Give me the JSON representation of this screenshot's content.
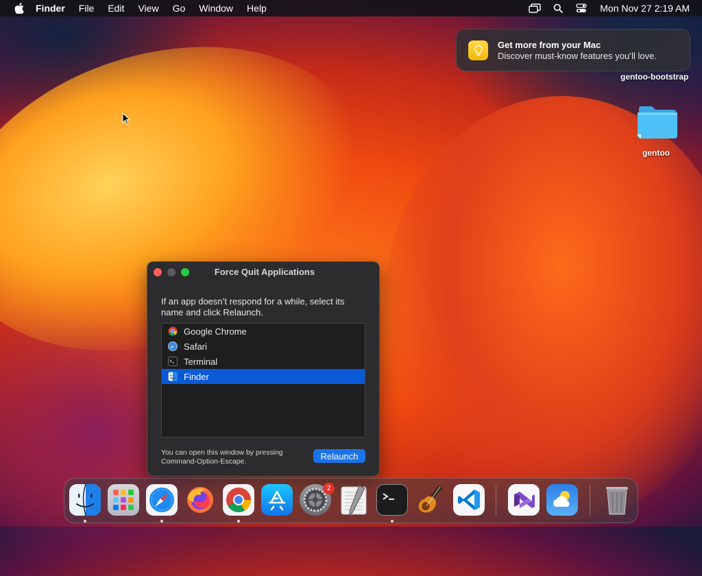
{
  "menubar": {
    "app": "Finder",
    "items": [
      "File",
      "Edit",
      "View",
      "Go",
      "Window",
      "Help"
    ],
    "clock": "Mon Nov 27  2:19 AM"
  },
  "notification": {
    "title": "Get more from your Mac",
    "body": "Discover must-know features you’ll love."
  },
  "desktop": {
    "items": [
      {
        "label": "gentoo-bootstrap"
      },
      {
        "label": "gentoo"
      }
    ]
  },
  "force_quit": {
    "title": "Force Quit Applications",
    "instructions": "If an app doesn’t respond for a while, select its name and click Relaunch.",
    "apps": [
      {
        "name": "Google Chrome",
        "icon": "chrome-icon",
        "selected": false
      },
      {
        "name": "Safari",
        "icon": "safari-icon",
        "selected": false
      },
      {
        "name": "Terminal",
        "icon": "terminal-icon",
        "selected": false
      },
      {
        "name": "Finder",
        "icon": "finder-icon",
        "selected": true
      }
    ],
    "hint": "You can open this window by pressing Command-Option-Escape.",
    "button_label": "Relaunch"
  },
  "dock": {
    "items": [
      {
        "name": "finder-icon",
        "running": true
      },
      {
        "name": "launchpad-icon",
        "running": false
      },
      {
        "name": "safari-icon",
        "running": true
      },
      {
        "name": "firefox-icon",
        "running": false
      },
      {
        "name": "chrome-icon",
        "running": true
      },
      {
        "name": "app-store-icon",
        "running": false
      },
      {
        "name": "system-settings-icon",
        "running": false,
        "badge": "2"
      },
      {
        "name": "textedit-icon",
        "running": false
      },
      {
        "name": "terminal-icon",
        "running": true
      },
      {
        "name": "garageband-icon",
        "running": false
      },
      {
        "name": "vscode-icon",
        "running": false
      },
      {
        "name": "visual-studio-icon",
        "running": false
      },
      {
        "name": "weather-icon",
        "running": false
      },
      {
        "name": "trash-icon",
        "running": false
      }
    ]
  },
  "colors": {
    "selection": "#0a5ad8",
    "relaunch_button": "#1a73e8",
    "close": "#ff5f57",
    "zoom": "#28c840"
  }
}
